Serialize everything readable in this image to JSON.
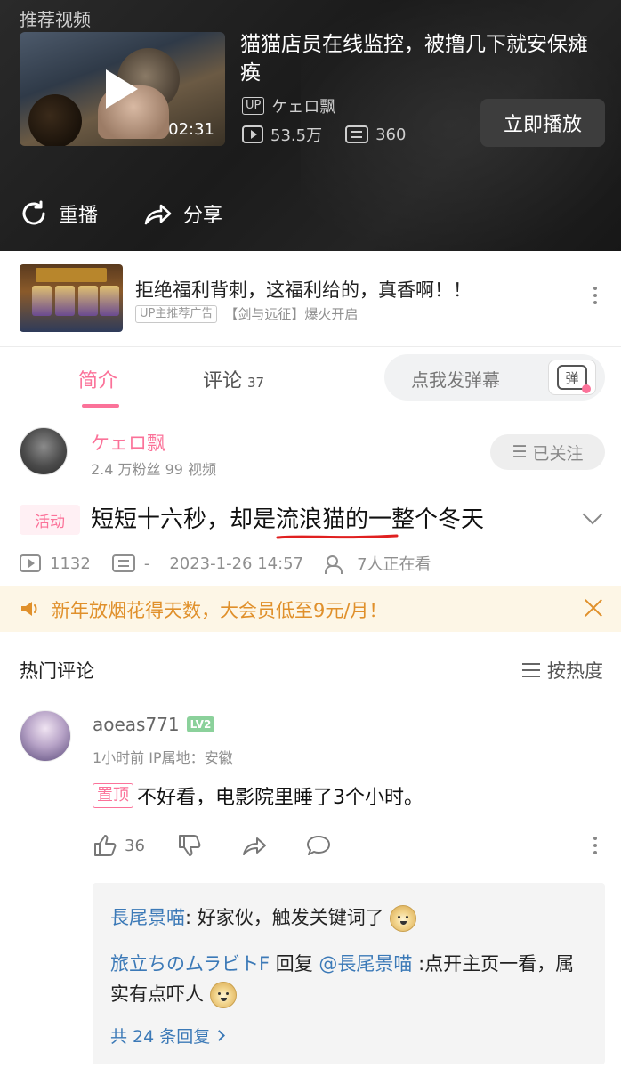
{
  "recommended": {
    "label": "推荐视频",
    "duration": "02:31",
    "title": "猫猫店员在线监控，被撸几下就安保瘫痪",
    "up_badge": "UP",
    "uploader": "ケェロ飘",
    "views": "53.5万",
    "danmaku_count": "360",
    "play_now_label": "立即播放"
  },
  "end_actions": {
    "replay_label": "重播",
    "share_label": "分享"
  },
  "ad": {
    "title": "拒绝福利背刺，这福利给的，真香啊！！",
    "tag": "UP主推荐广告",
    "game": "【剑与远征】爆火开启"
  },
  "tabs": {
    "intro_label": "简介",
    "comments_label": "评论",
    "comments_count": "37",
    "danmaku_placeholder": "点我发弹幕",
    "danmaku_icon_char": "弹"
  },
  "uploader": {
    "name": "ケェロ飘",
    "meta": "2.4 万粉丝  99 视频",
    "follow_label": "已关注"
  },
  "video": {
    "activity_tag": "活动",
    "title_a": "短短十六秒，却是",
    "title_b": "流浪猫的",
    "title_c": "一整个冬天",
    "plays": "1132",
    "danmaku": "-",
    "datetime": "2023-1-26 14:57",
    "watching": "7人正在看"
  },
  "notice": {
    "text": "新年放烟花得天数，大会员低至9元/月！"
  },
  "comments": {
    "header": "热门评论",
    "sort_label": "按热度",
    "top": {
      "user": "aoeas771",
      "level": "LV2",
      "meta": "1小时前  IP属地：安徽",
      "pin_label": "置顶",
      "text": "不好看，电影院里睡了3个小时。",
      "likes": "36"
    },
    "replies": [
      {
        "user": "長尾景喵",
        "sep": ": ",
        "text": "好家伙，触发关键词了"
      },
      {
        "user": "旅立ちのムラビトF",
        "mid": " 回复 ",
        "mention": "@長尾景喵",
        "text": " :点开主页一看，属实有点吓人"
      }
    ],
    "total_replies": "共 24 条回复"
  },
  "colors": {
    "accent_pink": "#fb7299",
    "link_blue": "#3b79b7",
    "notice_orange": "#e0902b"
  },
  "icons": [
    "play-triangle-icon",
    "replay-icon",
    "share-icon",
    "more-vertical-icon",
    "danmaku-icon",
    "list-icon",
    "chevron-down-icon",
    "views-icon",
    "danmaku-count-icon",
    "viewers-icon",
    "speaker-icon",
    "close-icon",
    "sort-icon",
    "like-icon",
    "dislike-icon",
    "forward-icon",
    "reply-icon",
    "doge-emoji-icon",
    "chevron-right-icon"
  ]
}
